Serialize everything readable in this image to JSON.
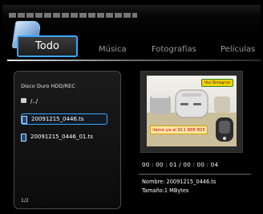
{
  "tabs": {
    "active": "Todo",
    "items": [
      "Música",
      "Fotografías",
      "Películas"
    ]
  },
  "browser": {
    "path": "Disco Duro  HDD/REC",
    "up": "/../",
    "files": [
      "20091215_0446.ts",
      "20091215_0446_01.ts"
    ],
    "page": "1/2"
  },
  "preview": {
    "badge": "Vivi Dimagrire",
    "phone_text": "llamo ya al 911 888 805",
    "timecode": "00 : 00 : 01 / 00 : 00 : 04",
    "name_line": "Nombre: 20091215_0446.ts",
    "size_line": "Tamaño:1 MBytes"
  },
  "colors": {
    "accent": "#3aa7ff"
  }
}
